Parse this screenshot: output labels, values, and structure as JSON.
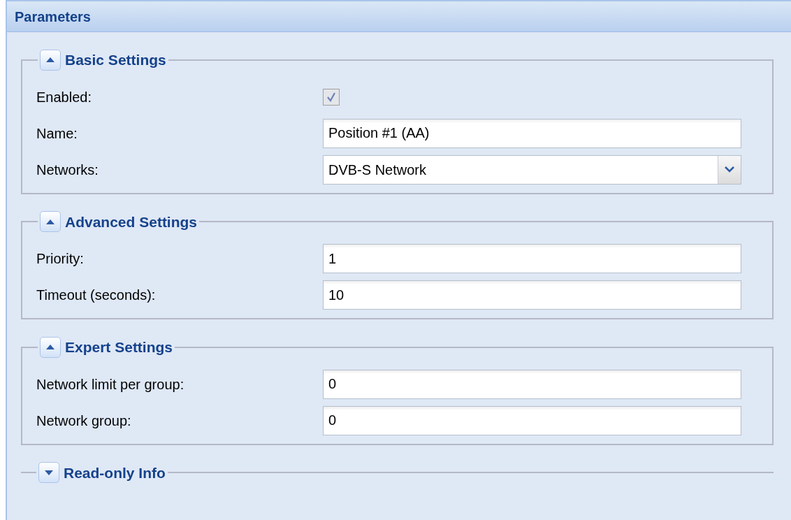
{
  "panel": {
    "title": "Parameters"
  },
  "sections": [
    {
      "title": "Basic Settings",
      "expanded": true,
      "fields": [
        {
          "kind": "checkbox",
          "label": "Enabled:",
          "checked": true,
          "disabled": true
        },
        {
          "kind": "text",
          "label": "Name:",
          "value": "Position #1 (AA)"
        },
        {
          "kind": "select",
          "label": "Networks:",
          "value": "DVB-S Network"
        }
      ]
    },
    {
      "title": "Advanced Settings",
      "expanded": true,
      "fields": [
        {
          "kind": "text",
          "label": "Priority:",
          "value": "1"
        },
        {
          "kind": "text",
          "label": "Timeout (seconds):",
          "value": "10"
        }
      ]
    },
    {
      "title": "Expert Settings",
      "expanded": true,
      "fields": [
        {
          "kind": "text",
          "label": "Network limit per group:",
          "value": "0"
        },
        {
          "kind": "text",
          "label": "Network group:",
          "value": "0"
        }
      ]
    },
    {
      "title": "Read-only Info",
      "expanded": false
    }
  ]
}
